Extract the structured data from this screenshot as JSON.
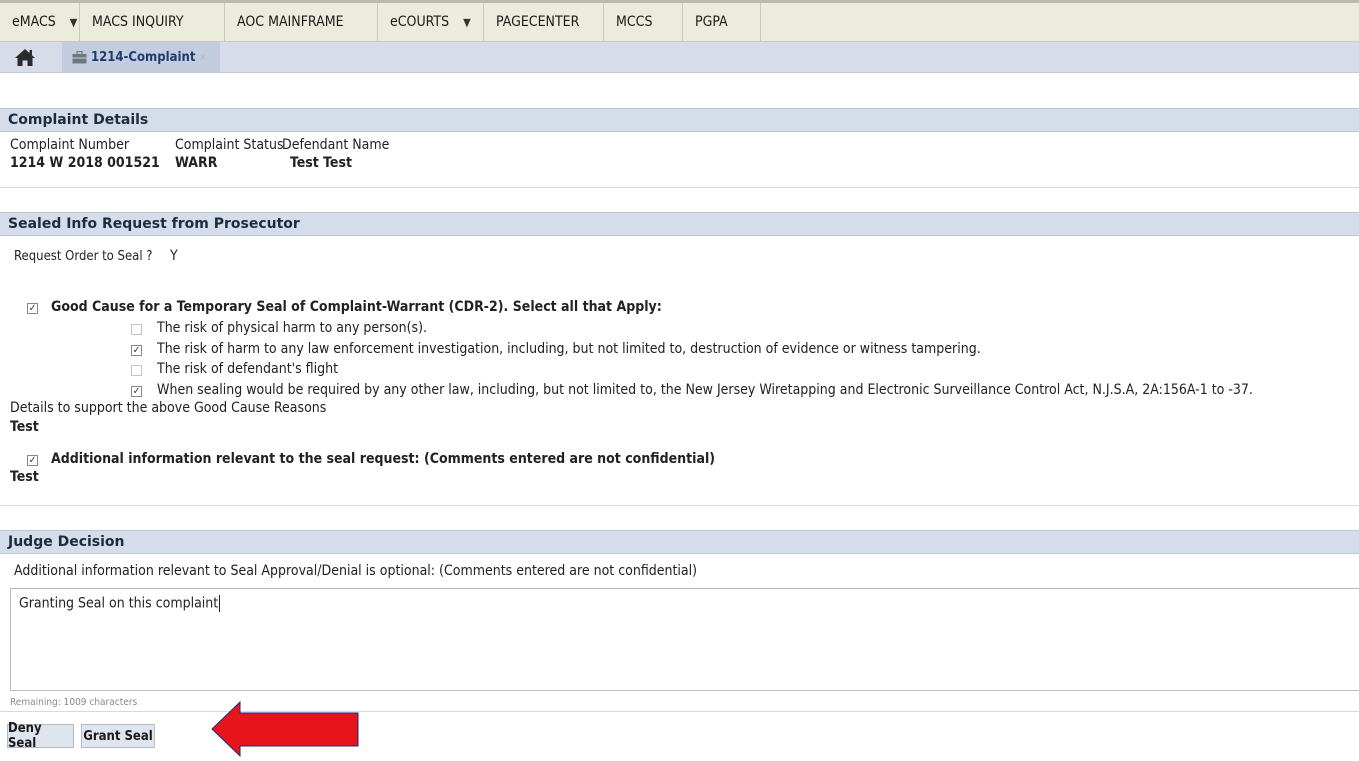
{
  "nav": {
    "items": [
      {
        "label": "eMACS",
        "dropdown": true
      },
      {
        "label": "MACS INQUIRY",
        "dropdown": false
      },
      {
        "label": "AOC MAINFRAME",
        "dropdown": false
      },
      {
        "label": "eCOURTS",
        "dropdown": true
      },
      {
        "label": "PAGECENTER",
        "dropdown": false
      },
      {
        "label": "MCCS",
        "dropdown": false
      },
      {
        "label": "PGPA",
        "dropdown": false
      }
    ],
    "caret": "▼"
  },
  "tabs": {
    "home_icon": "home-icon",
    "active_tab": {
      "label": "1214-Complaint",
      "icon": "briefcase-icon",
      "close": "×"
    }
  },
  "complaint_details": {
    "title": "Complaint Details",
    "headers": [
      "Complaint Number",
      "Complaint Status",
      "Defendant Name"
    ],
    "values": [
      "1214 W 2018 001521",
      "WARR",
      "Test Test"
    ]
  },
  "sealed_info": {
    "title": "Sealed Info Request from Prosecutor",
    "request_label": "Request Order to Seal ?",
    "request_value": "Y",
    "good_cause": {
      "checked": true,
      "label": "Good Cause for a Temporary Seal of Complaint-Warrant (CDR-2). Select all that Apply:",
      "options": [
        {
          "checked": false,
          "label": "The risk of physical harm to any person(s)."
        },
        {
          "checked": true,
          "label": "The risk of harm to any law enforcement investigation, including, but not limited to, destruction of evidence or witness tampering."
        },
        {
          "checked": false,
          "label": "The risk of defendant's flight"
        },
        {
          "checked": true,
          "label": "When sealing would be required by any other law, including, but not limited to, the New Jersey Wiretapping and Electronic Surveillance Control Act, N.J.S.A, 2A:156A-1 to -37."
        }
      ]
    },
    "details_label": "Details to support the above Good Cause Reasons",
    "details_value": "Test",
    "additional": {
      "checked": true,
      "label": "Additional information relevant to the seal request: (Comments entered are not confidential)",
      "value": "Test"
    }
  },
  "judge_decision": {
    "title": "Judge Decision",
    "instruction": "Additional information relevant to Seal Approval/Denial is optional: (Comments entered are not confidential)",
    "comment": "Granting Seal on this complaint",
    "remaining": "Remaining: 1009 characters"
  },
  "buttons": {
    "deny": "Deny Seal",
    "grant": "Grant Seal"
  },
  "colors": {
    "header_bg": "#d4dde9",
    "nav_bg": "#ececdd",
    "arrow": "#e8141b"
  }
}
